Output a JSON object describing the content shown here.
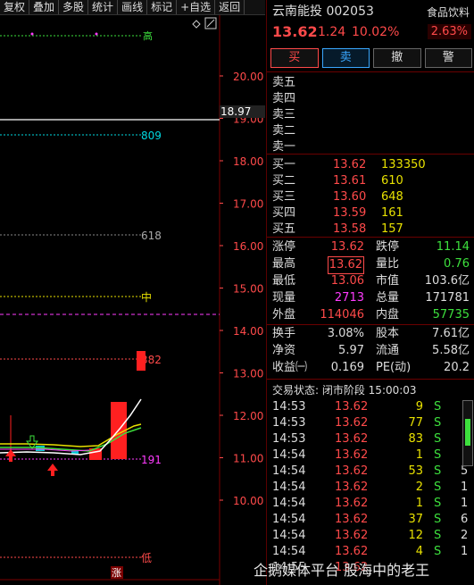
{
  "toolbar": [
    "复权",
    "叠加",
    "多股",
    "统计",
    "画线",
    "标记",
    "+自选",
    "返回"
  ],
  "chart": {
    "price_ticks": [
      "20.00",
      "19.00",
      "18.00",
      "17.00",
      "16.00",
      "15.00",
      "14.00",
      "13.00",
      "12.00",
      "11.00",
      "10.00"
    ],
    "current_level": "18.97",
    "fib_labels": [
      {
        "text": "809",
        "color": "#00d8e0"
      },
      {
        "text": "618",
        "color": "#aaaaaa"
      },
      {
        "text": "中",
        "color": "#e8e100"
      },
      {
        "text": "382",
        "color": "#ff4a4a"
      },
      {
        "text": "191",
        "color": "#ff3bff"
      },
      {
        "text": "低",
        "color": "#ff4a4a"
      }
    ],
    "top_mark": "高",
    "bottom_mark": "涨"
  },
  "header": {
    "name": "云南能投",
    "code": "002053",
    "sector": "食品饮料",
    "price": "13.62",
    "change": "1.24",
    "pct": "10.02%",
    "sector_pct": "2.63%"
  },
  "buttons": [
    "买",
    "卖",
    "撤",
    "警"
  ],
  "asks": [
    {
      "label": "卖五",
      "price": "",
      "vol": ""
    },
    {
      "label": "卖四",
      "price": "",
      "vol": ""
    },
    {
      "label": "卖三",
      "price": "",
      "vol": ""
    },
    {
      "label": "卖二",
      "price": "",
      "vol": ""
    },
    {
      "label": "卖一",
      "price": "",
      "vol": ""
    }
  ],
  "bids": [
    {
      "label": "买一",
      "price": "13.62",
      "vol": "133350"
    },
    {
      "label": "买二",
      "price": "13.61",
      "vol": "610"
    },
    {
      "label": "买三",
      "price": "13.60",
      "vol": "648"
    },
    {
      "label": "买四",
      "price": "13.59",
      "vol": "161"
    },
    {
      "label": "买五",
      "price": "13.58",
      "vol": "157"
    }
  ],
  "stats": [
    {
      "l1": "涨停",
      "v1": "13.62",
      "c1": "red",
      "l2": "跌停",
      "v2": "11.14",
      "c2": "green"
    },
    {
      "l1": "最高",
      "v1": "13.62",
      "c1": "red",
      "l2": "量比",
      "v2": "0.76",
      "c2": "green"
    },
    {
      "l1": "最低",
      "v1": "13.06",
      "c1": "red",
      "l2": "市值",
      "v2": "103.6亿",
      "c2": "white"
    },
    {
      "l1": "现量",
      "v1": "2713",
      "c1": "mag",
      "l2": "总量",
      "v2": "171781",
      "c2": "white"
    },
    {
      "l1": "外盘",
      "v1": "114046",
      "c1": "red",
      "l2": "内盘",
      "v2": "57735",
      "c2": "green"
    }
  ],
  "stats2": [
    {
      "l1": "换手",
      "v1": "3.08%",
      "l2": "股本",
      "v2": "7.61亿"
    },
    {
      "l1": "净资",
      "v1": "5.97",
      "l2": "流通",
      "v2": "5.58亿"
    },
    {
      "l1": "收益㈠",
      "v1": "0.169",
      "l2": "PE(动)",
      "v2": "20.2"
    }
  ],
  "status": "交易状态: 闭市阶段 15:00:03",
  "ticks": [
    {
      "t": "14:53",
      "p": "13.62",
      "v": "9",
      "s": "S",
      "n": ""
    },
    {
      "t": "14:53",
      "p": "13.62",
      "v": "77",
      "s": "S",
      "n": ""
    },
    {
      "t": "14:53",
      "p": "13.62",
      "v": "83",
      "s": "S",
      "n": ""
    },
    {
      "t": "14:54",
      "p": "13.62",
      "v": "1",
      "s": "S",
      "n": ""
    },
    {
      "t": "14:54",
      "p": "13.62",
      "v": "53",
      "s": "S",
      "n": "5"
    },
    {
      "t": "14:54",
      "p": "13.62",
      "v": "2",
      "s": "S",
      "n": "1"
    },
    {
      "t": "14:54",
      "p": "13.62",
      "v": "1",
      "s": "S",
      "n": "1"
    },
    {
      "t": "14:54",
      "p": "13.62",
      "v": "37",
      "s": "S",
      "n": "6"
    },
    {
      "t": "14:54",
      "p": "13.62",
      "v": "12",
      "s": "S",
      "n": "2"
    },
    {
      "t": "14:54",
      "p": "13.62",
      "v": "4",
      "s": "S",
      "n": "1"
    },
    {
      "t": "14:55",
      "p": "13.62",
      "v": "",
      "s": "",
      "n": ""
    }
  ],
  "watermark": "企鹅媒体平台 股海中的老王"
}
